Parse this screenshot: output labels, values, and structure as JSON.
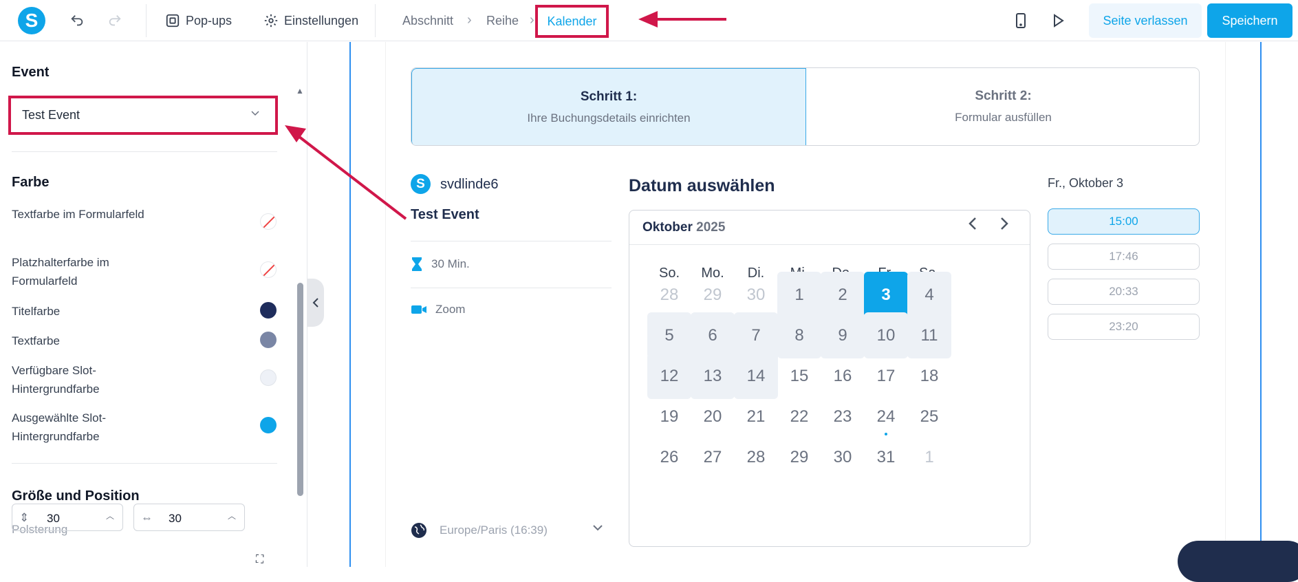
{
  "topbar": {
    "logo_letter": "S",
    "popups_label": "Pop-ups",
    "settings_label": "Einstellungen",
    "breadcrumb": [
      "Abschnitt",
      "Reihe",
      "Kalender"
    ],
    "leave_label": "Seite verlassen",
    "save_label": "Speichern",
    "icons": [
      "undo-icon",
      "redo-icon",
      "popup-icon",
      "gear-icon",
      "mobile-icon",
      "play-icon"
    ]
  },
  "sidebar": {
    "event_heading": "Event",
    "event_select_value": "Test Event",
    "color_heading": "Farbe",
    "color_rows": [
      {
        "label": "Textfarbe im Formularfeld",
        "color": "none"
      },
      {
        "label": "Platzhalterfarbe im Formularfeld",
        "color": "none"
      },
      {
        "label": "Titelfarbe",
        "color": "#1f2d5c"
      },
      {
        "label": "Textfarbe",
        "color": "#7a86a5"
      },
      {
        "label": "Verfügbare Slot-Hintergrundfarbe",
        "color": "#eef1f7"
      },
      {
        "label": "Ausgewählte Slot-Hintergrundfarbe",
        "color": "#0ea5e9"
      }
    ],
    "size_heading": "Größe und Position",
    "padding_label": "Polsterung",
    "padding_vertical": "30",
    "padding_horizontal": "30"
  },
  "booking": {
    "step1_title": "Schritt 1:",
    "step1_sub": "Ihre Buchungsdetails einrichten",
    "step2_title": "Schritt 2:",
    "step2_sub": "Formular ausfüllen",
    "host_letter": "S",
    "host_name": "svdlinde6",
    "event_name": "Test Event",
    "duration": "30 Min.",
    "location": "Zoom",
    "timezone": "Europe/Paris (16:39)"
  },
  "calendar": {
    "title": "Datum auswählen",
    "month": "Oktober",
    "year": "2025",
    "weekdays": [
      "So.",
      "Mo.",
      "Di.",
      "Mi.",
      "Do.",
      "Fr.",
      "Sa."
    ],
    "weeks": [
      [
        {
          "d": "28",
          "s": "muted"
        },
        {
          "d": "29",
          "s": "muted"
        },
        {
          "d": "30",
          "s": "muted"
        },
        {
          "d": "1",
          "s": "avail"
        },
        {
          "d": "2",
          "s": "avail"
        },
        {
          "d": "3",
          "s": "sel"
        },
        {
          "d": "4",
          "s": "avail"
        }
      ],
      [
        {
          "d": "5",
          "s": "avail"
        },
        {
          "d": "6",
          "s": "avail"
        },
        {
          "d": "7",
          "s": "avail"
        },
        {
          "d": "8",
          "s": "avail"
        },
        {
          "d": "9",
          "s": "avail"
        },
        {
          "d": "10",
          "s": "avail"
        },
        {
          "d": "11",
          "s": "avail"
        }
      ],
      [
        {
          "d": "12",
          "s": "avail"
        },
        {
          "d": "13",
          "s": "avail"
        },
        {
          "d": "14",
          "s": "avail"
        },
        {
          "d": "15",
          "s": ""
        },
        {
          "d": "16",
          "s": ""
        },
        {
          "d": "17",
          "s": ""
        },
        {
          "d": "18",
          "s": ""
        }
      ],
      [
        {
          "d": "19",
          "s": ""
        },
        {
          "d": "20",
          "s": ""
        },
        {
          "d": "21",
          "s": ""
        },
        {
          "d": "22",
          "s": ""
        },
        {
          "d": "23",
          "s": ""
        },
        {
          "d": "24",
          "s": "today"
        },
        {
          "d": "25",
          "s": ""
        }
      ],
      [
        {
          "d": "26",
          "s": ""
        },
        {
          "d": "27",
          "s": ""
        },
        {
          "d": "28",
          "s": ""
        },
        {
          "d": "29",
          "s": ""
        },
        {
          "d": "30",
          "s": ""
        },
        {
          "d": "31",
          "s": ""
        },
        {
          "d": "1",
          "s": "muted"
        }
      ]
    ]
  },
  "slots": {
    "date_label": "Fr., Oktober 3",
    "times": [
      "15:00",
      "17:46",
      "20:33",
      "23:20"
    ],
    "selected_index": 0
  },
  "colors": {
    "accent": "#0ea5e9",
    "highlight_red": "#d0174a",
    "navy": "#1f2d4d"
  }
}
